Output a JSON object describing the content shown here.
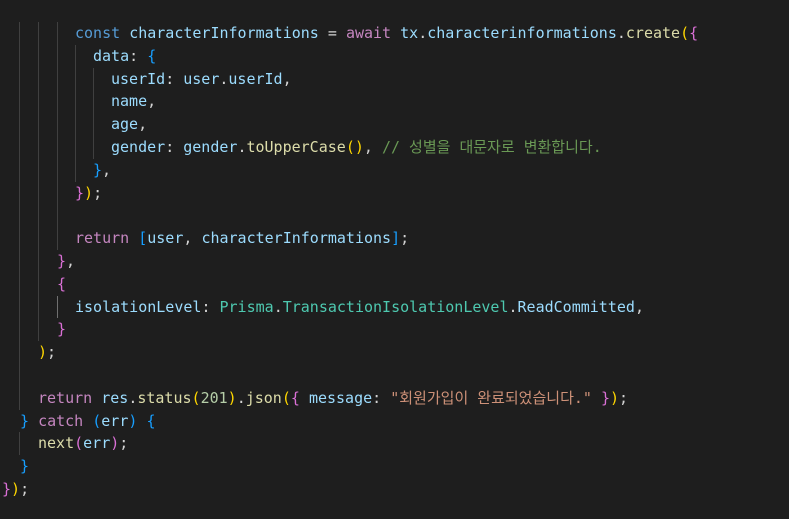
{
  "editor": {
    "theme": "dark",
    "background": "#1e1e1e",
    "token_colors": {
      "keyword": "#569cd6",
      "control": "#c586c0",
      "variable": "#9cdcfe",
      "function": "#dcdcaa",
      "class": "#4ec9b0",
      "constant": "#4fc1ff",
      "number": "#b5cea8",
      "string": "#ce9178",
      "comment": "#6a9955",
      "bracket_level_1": "#ffd700",
      "bracket_level_2": "#da70d6",
      "bracket_level_3": "#179fff"
    },
    "code_lines": [
      [
        {
          "t": "const",
          "c": "kw"
        },
        {
          "t": " ",
          "c": "pun"
        },
        {
          "t": "characterInformations",
          "c": "var"
        },
        {
          "t": " = ",
          "c": "pun"
        },
        {
          "t": "await",
          "c": "ctl"
        },
        {
          "t": " ",
          "c": "pun"
        },
        {
          "t": "tx",
          "c": "var"
        },
        {
          "t": ".",
          "c": "pun"
        },
        {
          "t": "characterinformations",
          "c": "var"
        },
        {
          "t": ".",
          "c": "pun"
        },
        {
          "t": "create",
          "c": "fn"
        },
        {
          "t": "(",
          "c": "b1"
        },
        {
          "t": "{",
          "c": "b2"
        }
      ],
      [
        {
          "t": "data",
          "c": "var"
        },
        {
          "t": ": ",
          "c": "pun"
        },
        {
          "t": "{",
          "c": "b3"
        }
      ],
      [
        {
          "t": "userId",
          "c": "var"
        },
        {
          "t": ": ",
          "c": "pun"
        },
        {
          "t": "user",
          "c": "var"
        },
        {
          "t": ".",
          "c": "pun"
        },
        {
          "t": "userId",
          "c": "var"
        },
        {
          "t": ",",
          "c": "pun"
        }
      ],
      [
        {
          "t": "name",
          "c": "var"
        },
        {
          "t": ",",
          "c": "pun"
        }
      ],
      [
        {
          "t": "age",
          "c": "var"
        },
        {
          "t": ",",
          "c": "pun"
        }
      ],
      [
        {
          "t": "gender",
          "c": "var"
        },
        {
          "t": ": ",
          "c": "pun"
        },
        {
          "t": "gender",
          "c": "var"
        },
        {
          "t": ".",
          "c": "pun"
        },
        {
          "t": "toUpperCase",
          "c": "fn"
        },
        {
          "t": "()",
          "c": "b1"
        },
        {
          "t": ", ",
          "c": "pun"
        },
        {
          "t": "// 성별을 대문자로 변환합니다.",
          "c": "com"
        }
      ],
      [
        {
          "t": "}",
          "c": "b3"
        },
        {
          "t": ",",
          "c": "pun"
        }
      ],
      [
        {
          "t": "}",
          "c": "b2"
        },
        {
          "t": ")",
          "c": "b1"
        },
        {
          "t": ";",
          "c": "pun"
        }
      ],
      [],
      [
        {
          "t": "return",
          "c": "ctl"
        },
        {
          "t": " ",
          "c": "pun"
        },
        {
          "t": "[",
          "c": "b3"
        },
        {
          "t": "user",
          "c": "var"
        },
        {
          "t": ", ",
          "c": "pun"
        },
        {
          "t": "characterInformations",
          "c": "var"
        },
        {
          "t": "]",
          "c": "b3"
        },
        {
          "t": ";",
          "c": "pun"
        }
      ],
      [
        {
          "t": "}",
          "c": "b2"
        },
        {
          "t": ",",
          "c": "pun"
        }
      ],
      [
        {
          "t": "{",
          "c": "b2"
        }
      ],
      [
        {
          "t": "isolationLevel",
          "c": "var"
        },
        {
          "t": ": ",
          "c": "pun"
        },
        {
          "t": "Prisma",
          "c": "cls"
        },
        {
          "t": ".",
          "c": "pun"
        },
        {
          "t": "TransactionIsolationLevel",
          "c": "cls"
        },
        {
          "t": ".",
          "c": "pun"
        },
        {
          "t": "ReadCommitted",
          "c": "var"
        },
        {
          "t": ",",
          "c": "pun"
        }
      ],
      [
        {
          "t": "}",
          "c": "b2"
        }
      ],
      [
        {
          "t": ")",
          "c": "b1"
        },
        {
          "t": ";",
          "c": "pun"
        }
      ],
      [],
      [
        {
          "t": "return",
          "c": "ctl"
        },
        {
          "t": " ",
          "c": "pun"
        },
        {
          "t": "res",
          "c": "var"
        },
        {
          "t": ".",
          "c": "pun"
        },
        {
          "t": "status",
          "c": "fn"
        },
        {
          "t": "(",
          "c": "b1"
        },
        {
          "t": "201",
          "c": "num"
        },
        {
          "t": ")",
          "c": "b1"
        },
        {
          "t": ".",
          "c": "pun"
        },
        {
          "t": "json",
          "c": "fn"
        },
        {
          "t": "(",
          "c": "b1"
        },
        {
          "t": "{",
          "c": "b2"
        },
        {
          "t": " ",
          "c": "pun"
        },
        {
          "t": "message",
          "c": "var"
        },
        {
          "t": ": ",
          "c": "pun"
        },
        {
          "t": "\"회원가입이 완료되었습니다.\"",
          "c": "str"
        },
        {
          "t": " ",
          "c": "pun"
        },
        {
          "t": "}",
          "c": "b2"
        },
        {
          "t": ")",
          "c": "b1"
        },
        {
          "t": ";",
          "c": "pun"
        }
      ],
      [
        {
          "t": "}",
          "c": "b3"
        },
        {
          "t": " ",
          "c": "pun"
        },
        {
          "t": "catch",
          "c": "ctl"
        },
        {
          "t": " ",
          "c": "pun"
        },
        {
          "t": "(",
          "c": "b3"
        },
        {
          "t": "err",
          "c": "var"
        },
        {
          "t": ")",
          "c": "b3"
        },
        {
          "t": " ",
          "c": "pun"
        },
        {
          "t": "{",
          "c": "b3"
        }
      ],
      [
        {
          "t": "next",
          "c": "fn"
        },
        {
          "t": "(",
          "c": "b2"
        },
        {
          "t": "err",
          "c": "var"
        },
        {
          "t": ")",
          "c": "b2"
        },
        {
          "t": ";",
          "c": "pun"
        }
      ],
      [
        {
          "t": "}",
          "c": "b3"
        }
      ],
      [
        {
          "t": "}",
          "c": "b2"
        },
        {
          "t": ")",
          "c": "b1"
        },
        {
          "t": ";",
          "c": "pun"
        }
      ]
    ]
  }
}
